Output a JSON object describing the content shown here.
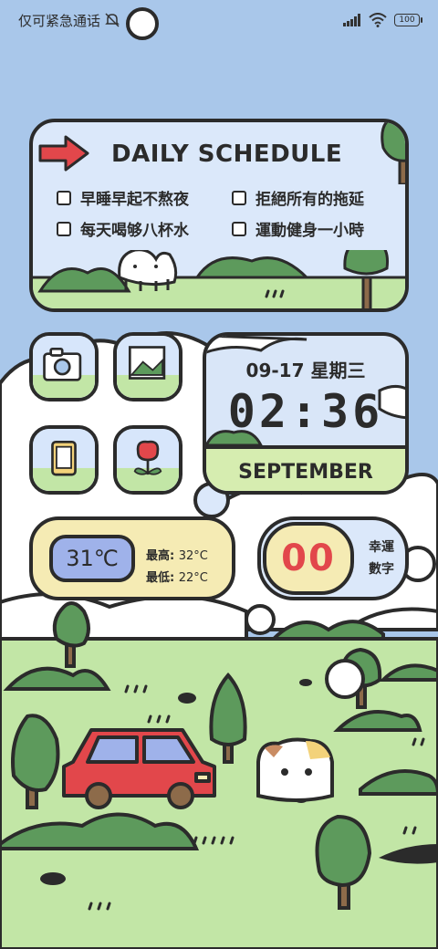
{
  "status_bar": {
    "left_text": "仅可紧急通话",
    "battery": "100",
    "icons": [
      "mute-icon",
      "signal-icon",
      "wifi-icon",
      "battery-icon"
    ]
  },
  "schedule": {
    "title": "DAILY SCHEDULE",
    "tasks": [
      {
        "label": "早睡早起不熬夜",
        "checked": false
      },
      {
        "label": "拒絕所有的拖延",
        "checked": false
      },
      {
        "label": "每天喝够八杯水",
        "checked": false
      },
      {
        "label": "運動健身一小時",
        "checked": false
      }
    ]
  },
  "apps": [
    {
      "name": "camera",
      "icon": "camera-icon"
    },
    {
      "name": "gallery",
      "icon": "gallery-icon"
    },
    {
      "name": "phone",
      "icon": "phone-icon"
    },
    {
      "name": "flower",
      "icon": "flower-icon"
    }
  ],
  "clock": {
    "date": "09-17 星期三",
    "time": "02:36",
    "month": "SEPTEMBER"
  },
  "weather": {
    "temp": "31℃",
    "high_label": "最高:",
    "high_value": "32°C",
    "low_label": "最低:",
    "low_value": "22°C"
  },
  "lucky": {
    "number": "00",
    "label": "幸運數字"
  },
  "colors": {
    "sky": "#a9c7ea",
    "grass": "#c2e6a6",
    "tree": "#5d9a5c",
    "car": "#e2474b",
    "weather_bg": "#f5ebb4",
    "temp_box": "#9fb2ea",
    "lucky_red": "#e2474b"
  }
}
